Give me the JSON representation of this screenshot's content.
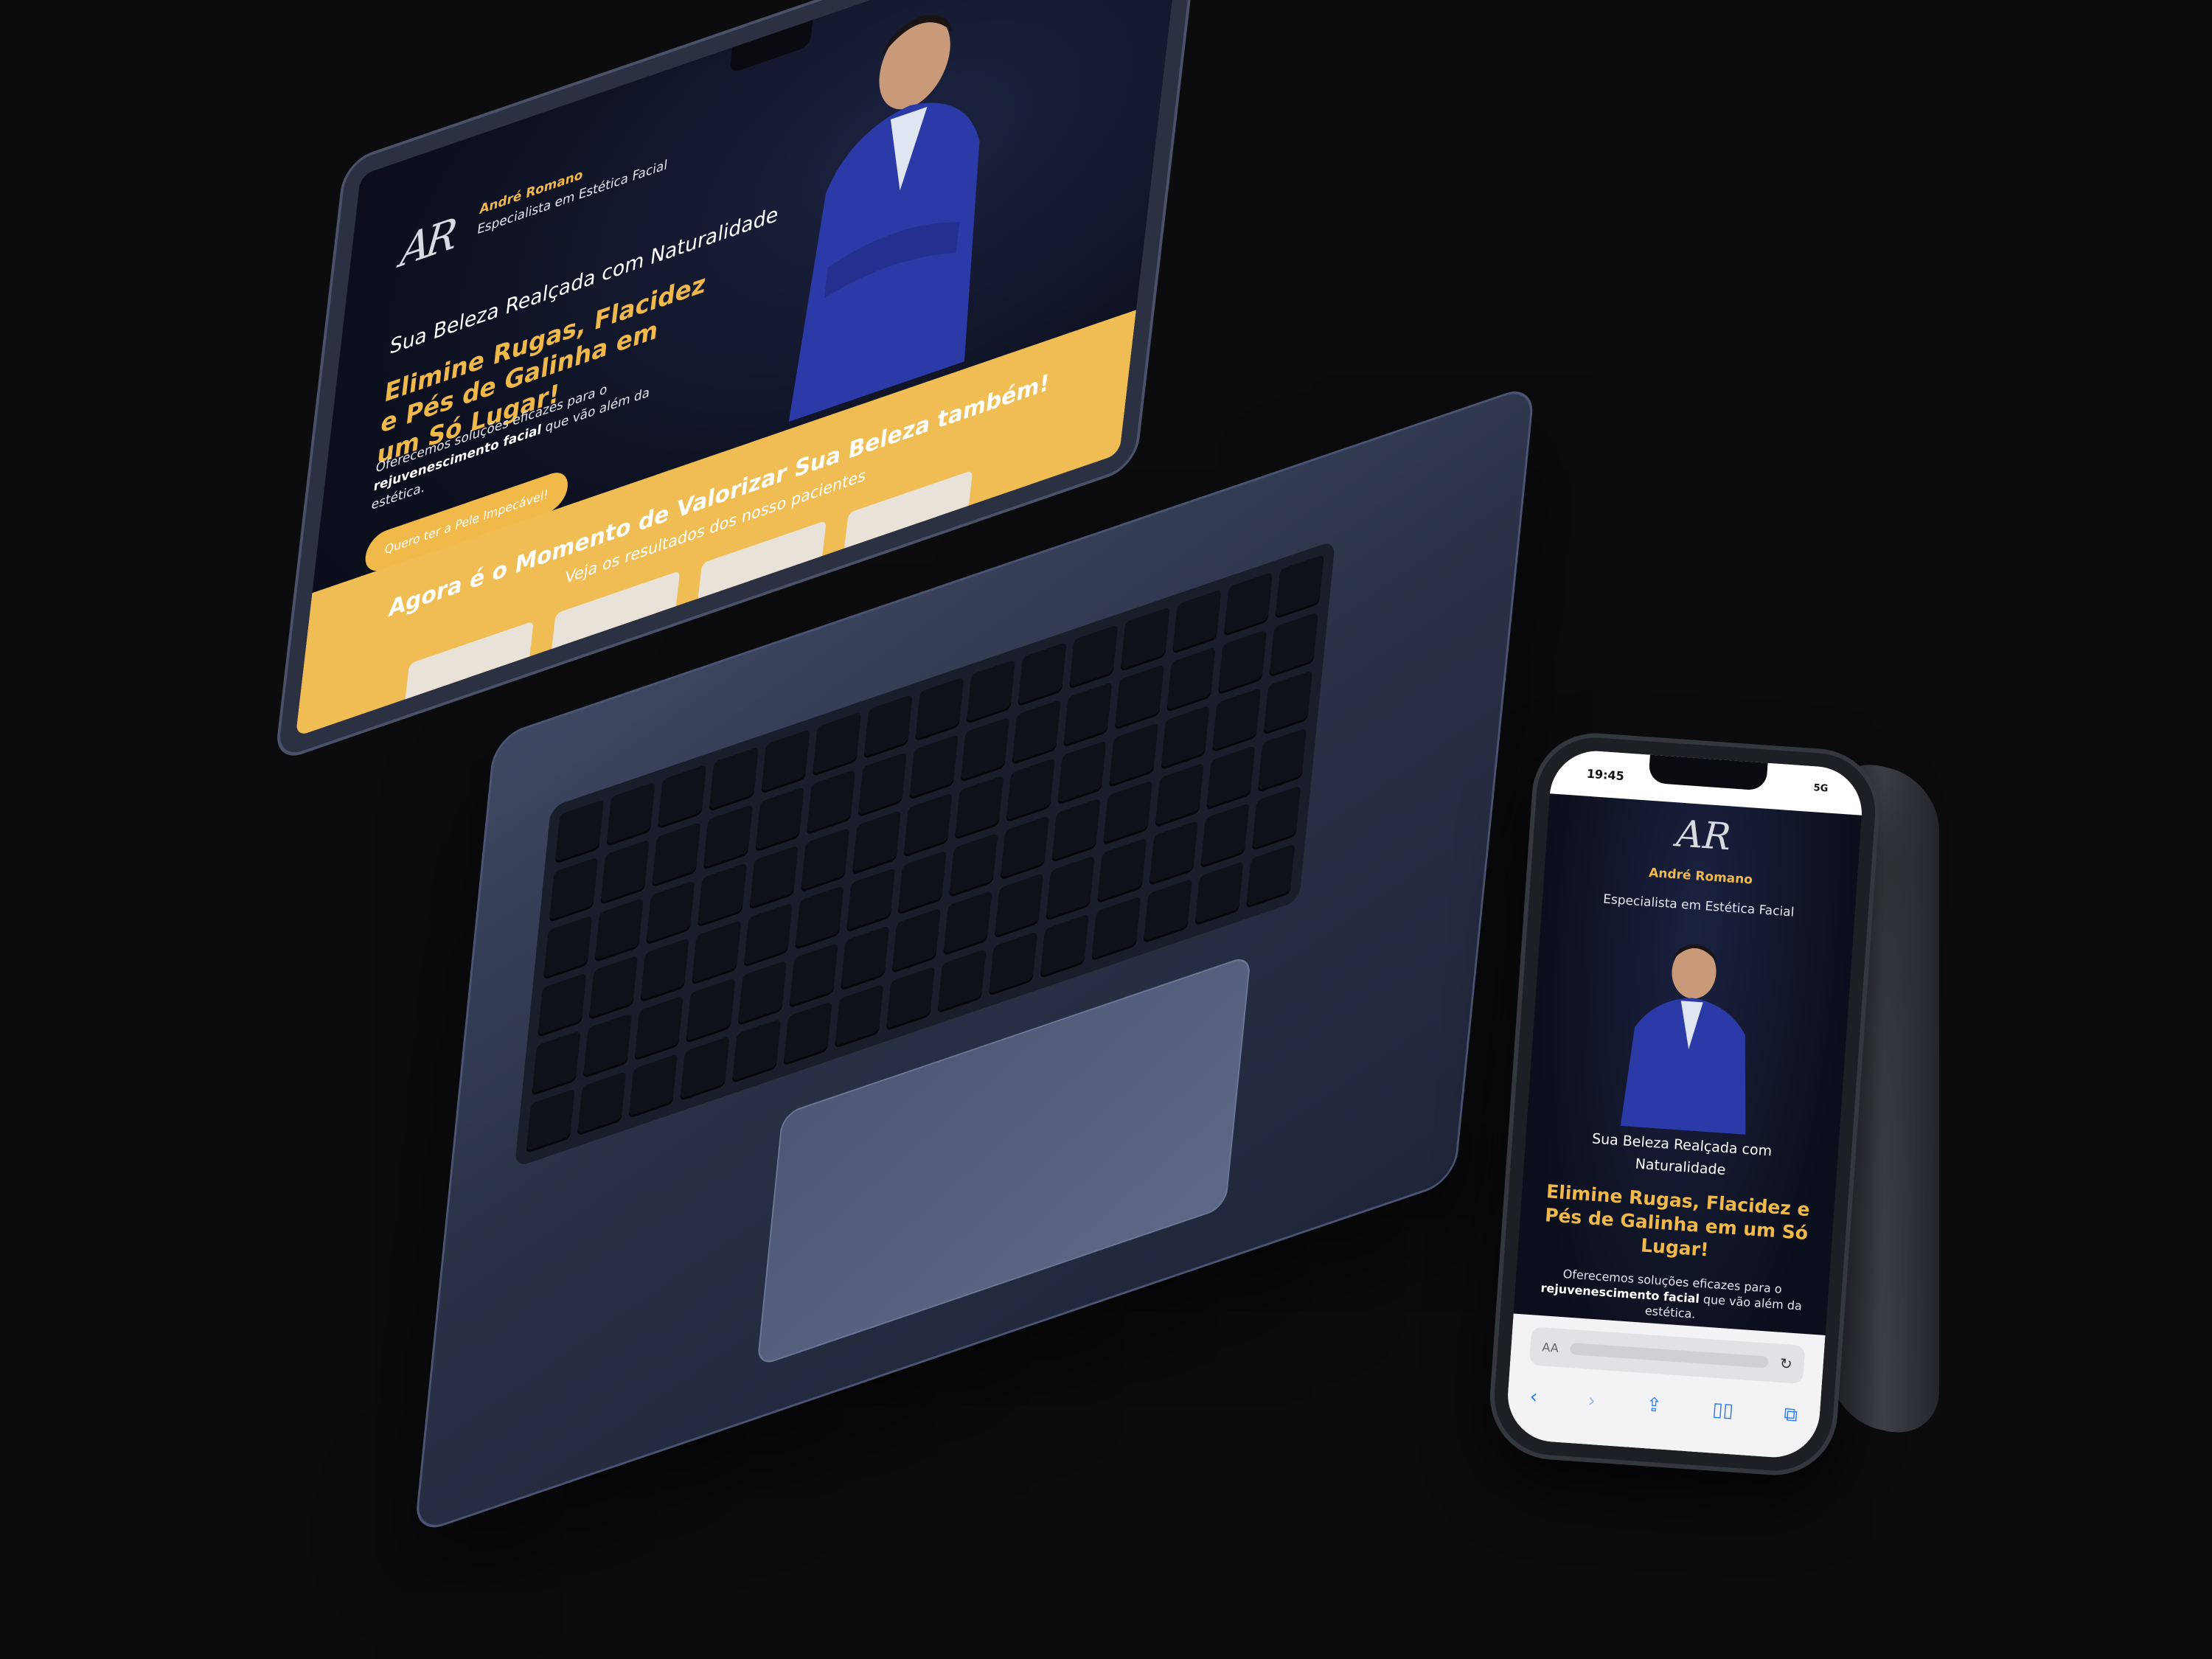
{
  "laptop": {
    "logo": "AR",
    "brand_name": "André Romano",
    "brand_subtitle": "Especialista em Estética Facial",
    "hero_kicker": "Sua Beleza Realçada com Naturalidade",
    "hero_title": "Elimine Rugas, Flacidez e Pés de Galinha em um Só Lugar!",
    "hero_text_pre": "Oferecemos soluções eficazes para o ",
    "hero_text_bold": "rejuvenescimento facial",
    "hero_text_post": " que vão além da estética.",
    "cta_label": "Quero ter a Pele Impecável!",
    "band_title": "Agora é o Momento de Valorizar Sua Beleza também!",
    "band_subtitle": "Veja os resultados dos nosso pacientes"
  },
  "phone": {
    "time": "19:45",
    "signal": "5G",
    "logo": "AR",
    "brand_name": "André Romano",
    "brand_subtitle": "Especialista em Estética Facial",
    "hero_kicker": "Sua Beleza Realçada com Naturalidade",
    "hero_title": "Elimine Rugas, Flacidez e Pés de Galinha em um Só Lugar!",
    "hero_text_pre": "Oferecemos soluções eficazes para o ",
    "hero_text_bold": "rejuvenescimento facial",
    "hero_text_post": " que vão além da estética.",
    "address_label": "AA"
  },
  "colors": {
    "accent": "#f0b94a",
    "background": "#0c0b0e",
    "whatsapp": "#3cc84b"
  }
}
